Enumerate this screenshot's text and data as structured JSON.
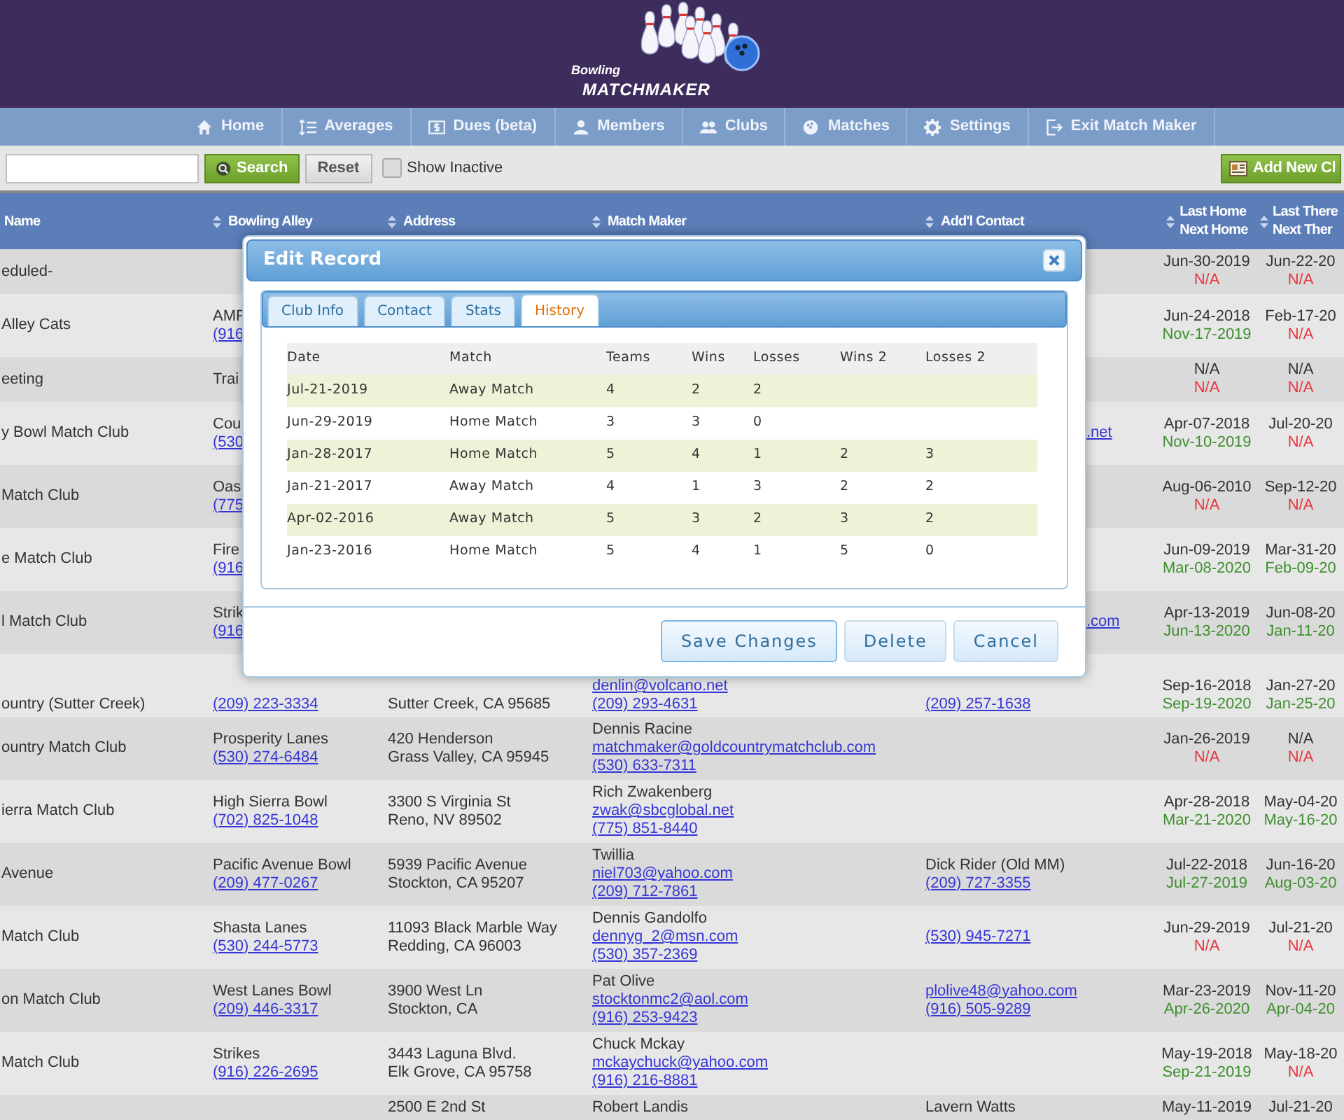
{
  "logo": {
    "script": "Bowling",
    "wordmark": "MATCHMAKER"
  },
  "nav": [
    {
      "label": "Home"
    },
    {
      "label": "Averages"
    },
    {
      "label": "Dues (beta)"
    },
    {
      "label": "Members"
    },
    {
      "label": "Clubs"
    },
    {
      "label": "Matches"
    },
    {
      "label": "Settings"
    },
    {
      "label": "Exit Match Maker"
    }
  ],
  "toolbar": {
    "search_button": "Search",
    "reset_button": "Reset",
    "show_inactive": {
      "label": "Show Inactive",
      "checked": false
    },
    "add_button": "Add New Cl"
  },
  "table": {
    "columns": [
      {
        "lines": [
          "Name"
        ]
      },
      {
        "lines": [
          "Bowling Alley"
        ]
      },
      {
        "lines": [
          "Address"
        ]
      },
      {
        "lines": [
          "Match Maker"
        ]
      },
      {
        "lines": [
          "Add'l Contact"
        ]
      },
      {
        "lines": [
          "Last Home",
          "Next Home"
        ]
      },
      {
        "lines": [
          "Last There",
          "Next Ther"
        ]
      }
    ],
    "rows": [
      {
        "cells": [
          [
            {
              "text": "eduled-",
              "kind": "text"
            }
          ],
          [],
          [],
          [],
          [],
          [
            {
              "text": "Jun-30-2019",
              "kind": "date"
            },
            {
              "text": "N/A",
              "kind": "next_none"
            }
          ],
          [
            {
              "text": "Jun-22-20",
              "kind": "date"
            },
            {
              "text": "N/A",
              "kind": "next_none"
            }
          ]
        ]
      },
      {
        "cells": [
          [
            {
              "text": "Alley Cats",
              "kind": "text"
            }
          ],
          [
            {
              "text": "AMF",
              "kind": "text"
            },
            {
              "text": "(916",
              "kind": "link"
            }
          ],
          [],
          [],
          [],
          [
            {
              "text": "Jun-24-2018",
              "kind": "date"
            },
            {
              "text": "Nov-17-2019",
              "kind": "next_set"
            }
          ],
          [
            {
              "text": "Feb-17-20",
              "kind": "date"
            },
            {
              "text": "N/A",
              "kind": "next_none"
            }
          ]
        ]
      },
      {
        "cells": [
          [
            {
              "text": "eeting",
              "kind": "text"
            }
          ],
          [
            {
              "text": "Trai",
              "kind": "text"
            }
          ],
          [],
          [],
          [],
          [
            {
              "text": "N/A",
              "kind": "date"
            },
            {
              "text": "N/A",
              "kind": "next_none"
            }
          ],
          [
            {
              "text": "N/A",
              "kind": "date"
            },
            {
              "text": "N/A",
              "kind": "next_none"
            }
          ]
        ]
      },
      {
        "cells": [
          [
            {
              "text": "y Bowl Match Club",
              "kind": "text"
            }
          ],
          [
            {
              "text": "Cou",
              "kind": "text"
            },
            {
              "text": "(530",
              "kind": "link"
            }
          ],
          [],
          [],
          [
            {
              "text": ".net",
              "kind": "tail_link"
            }
          ],
          [
            {
              "text": "Apr-07-2018",
              "kind": "date"
            },
            {
              "text": "Nov-10-2019",
              "kind": "next_set"
            }
          ],
          [
            {
              "text": "Jul-20-20",
              "kind": "date"
            },
            {
              "text": "N/A",
              "kind": "next_none"
            }
          ]
        ]
      },
      {
        "cells": [
          [
            {
              "text": "Match Club",
              "kind": "text"
            }
          ],
          [
            {
              "text": "Oas",
              "kind": "text"
            },
            {
              "text": "(775",
              "kind": "link"
            }
          ],
          [],
          [],
          [],
          [
            {
              "text": "Aug-06-2010",
              "kind": "date"
            },
            {
              "text": "N/A",
              "kind": "next_none"
            }
          ],
          [
            {
              "text": "Sep-12-20",
              "kind": "date"
            },
            {
              "text": "N/A",
              "kind": "next_none"
            }
          ]
        ]
      },
      {
        "cells": [
          [
            {
              "text": "e Match Club",
              "kind": "text"
            }
          ],
          [
            {
              "text": "Fire",
              "kind": "text"
            },
            {
              "text": "(916",
              "kind": "link"
            }
          ],
          [],
          [],
          [],
          [
            {
              "text": "Jun-09-2019",
              "kind": "date"
            },
            {
              "text": "Mar-08-2020",
              "kind": "next_set"
            }
          ],
          [
            {
              "text": "Mar-31-20",
              "kind": "date"
            },
            {
              "text": "Feb-09-20",
              "kind": "next_set"
            }
          ]
        ]
      },
      {
        "cells": [
          [
            {
              "text": "l Match Club",
              "kind": "text"
            }
          ],
          [
            {
              "text": "Strik",
              "kind": "text"
            },
            {
              "text": "(916",
              "kind": "link"
            }
          ],
          [],
          [],
          [
            {
              "text": ".com",
              "kind": "tail_link"
            }
          ],
          [
            {
              "text": "Apr-13-2019",
              "kind": "date"
            },
            {
              "text": "Jun-13-2020",
              "kind": "next_set"
            }
          ],
          [
            {
              "text": "Jun-08-20",
              "kind": "date"
            },
            {
              "text": "Jan-11-20",
              "kind": "next_set"
            }
          ]
        ]
      },
      {
        "covered_top": true,
        "cells": [
          [
            {
              "text": "ountry (Sutter Creek)",
              "kind": "text"
            }
          ],
          [
            {
              "text": "(209) 223-3334",
              "kind": "link"
            }
          ],
          [
            {
              "text": "Sutter Creek, CA 95685",
              "kind": "text"
            }
          ],
          [
            {
              "text": "denlin@volcano.net",
              "kind": "link"
            },
            {
              "text": "(209) 293-4631",
              "kind": "link"
            }
          ],
          [
            {
              "text": "(209) 257-1638",
              "kind": "link"
            }
          ],
          [
            {
              "text": "Sep-16-2018",
              "kind": "date"
            },
            {
              "text": "Sep-19-2020",
              "kind": "next_set"
            }
          ],
          [
            {
              "text": "Jan-27-20",
              "kind": "date"
            },
            {
              "text": "Jan-25-20",
              "kind": "next_set"
            }
          ]
        ]
      },
      {
        "cells": [
          [
            {
              "text": "ountry Match Club",
              "kind": "text"
            }
          ],
          [
            {
              "text": "Prosperity Lanes",
              "kind": "text"
            },
            {
              "text": "(530) 274-6484",
              "kind": "link"
            }
          ],
          [
            {
              "text": "420 Henderson",
              "kind": "text"
            },
            {
              "text": "Grass Valley, CA 95945",
              "kind": "text"
            }
          ],
          [
            {
              "text": "Dennis Racine",
              "kind": "text"
            },
            {
              "text": "matchmaker@goldcountrymatchclub.com",
              "kind": "link"
            },
            {
              "text": "(530) 633-7311",
              "kind": "link"
            }
          ],
          [],
          [
            {
              "text": "Jan-26-2019",
              "kind": "date"
            },
            {
              "text": "N/A",
              "kind": "next_none"
            }
          ],
          [
            {
              "text": "N/A",
              "kind": "date"
            },
            {
              "text": "N/A",
              "kind": "next_none"
            }
          ]
        ]
      },
      {
        "cells": [
          [
            {
              "text": "ierra Match Club",
              "kind": "text"
            }
          ],
          [
            {
              "text": "High Sierra Bowl",
              "kind": "text"
            },
            {
              "text": "(702) 825-1048",
              "kind": "link"
            }
          ],
          [
            {
              "text": "3300 S Virginia St",
              "kind": "text"
            },
            {
              "text": "Reno, NV 89502",
              "kind": "text"
            }
          ],
          [
            {
              "text": "Rich Zwakenberg",
              "kind": "text"
            },
            {
              "text": "zwak@sbcglobal.net",
              "kind": "link"
            },
            {
              "text": "(775) 851-8440",
              "kind": "link"
            }
          ],
          [],
          [
            {
              "text": "Apr-28-2018",
              "kind": "date"
            },
            {
              "text": "Mar-21-2020",
              "kind": "next_set"
            }
          ],
          [
            {
              "text": "May-04-20",
              "kind": "date"
            },
            {
              "text": "May-16-20",
              "kind": "next_set"
            }
          ]
        ]
      },
      {
        "cells": [
          [
            {
              "text": "Avenue",
              "kind": "text"
            }
          ],
          [
            {
              "text": "Pacific Avenue Bowl",
              "kind": "text"
            },
            {
              "text": "(209) 477-0267",
              "kind": "link"
            }
          ],
          [
            {
              "text": "5939 Pacific Avenue",
              "kind": "text"
            },
            {
              "text": "Stockton, CA 95207",
              "kind": "text"
            }
          ],
          [
            {
              "text": "Twillia",
              "kind": "text"
            },
            {
              "text": "niel703@yahoo.com",
              "kind": "link"
            },
            {
              "text": "(209) 712-7861",
              "kind": "link"
            }
          ],
          [
            {
              "text": "Dick Rider (Old MM)",
              "kind": "text"
            },
            {
              "text": "(209) 727-3355",
              "kind": "link"
            }
          ],
          [
            {
              "text": "Jul-22-2018",
              "kind": "date"
            },
            {
              "text": "Jul-27-2019",
              "kind": "next_set"
            }
          ],
          [
            {
              "text": "Jun-16-20",
              "kind": "date"
            },
            {
              "text": "Aug-03-20",
              "kind": "next_set"
            }
          ]
        ]
      },
      {
        "cells": [
          [
            {
              "text": "Match Club",
              "kind": "text"
            }
          ],
          [
            {
              "text": "Shasta Lanes",
              "kind": "text"
            },
            {
              "text": "(530) 244-5773",
              "kind": "link"
            }
          ],
          [
            {
              "text": "11093 Black Marble Way",
              "kind": "text"
            },
            {
              "text": "Redding, CA 96003",
              "kind": "text"
            }
          ],
          [
            {
              "text": "Dennis Gandolfo",
              "kind": "text"
            },
            {
              "text": "dennyg_2@msn.com",
              "kind": "link"
            },
            {
              "text": "(530) 357-2369",
              "kind": "link"
            }
          ],
          [
            {
              "text": "(530) 945-7271",
              "kind": "link"
            }
          ],
          [
            {
              "text": "Jun-29-2019",
              "kind": "date"
            },
            {
              "text": "N/A",
              "kind": "next_none"
            }
          ],
          [
            {
              "text": "Jul-21-20",
              "kind": "date"
            },
            {
              "text": "N/A",
              "kind": "next_none"
            }
          ]
        ]
      },
      {
        "cells": [
          [
            {
              "text": "on Match Club",
              "kind": "text"
            }
          ],
          [
            {
              "text": "West Lanes Bowl",
              "kind": "text"
            },
            {
              "text": "(209) 446-3317",
              "kind": "link"
            }
          ],
          [
            {
              "text": "3900 West Ln",
              "kind": "text"
            },
            {
              "text": "Stockton, CA",
              "kind": "text"
            }
          ],
          [
            {
              "text": "Pat Olive",
              "kind": "text"
            },
            {
              "text": "stocktonmc2@aol.com",
              "kind": "link"
            },
            {
              "text": "(916) 253-9423",
              "kind": "link"
            }
          ],
          [
            {
              "text": "plolive48@yahoo.com",
              "kind": "link"
            },
            {
              "text": "(916) 505-9289",
              "kind": "link"
            }
          ],
          [
            {
              "text": "Mar-23-2019",
              "kind": "date"
            },
            {
              "text": "Apr-26-2020",
              "kind": "next_set"
            }
          ],
          [
            {
              "text": "Nov-11-20",
              "kind": "date"
            },
            {
              "text": "Apr-04-20",
              "kind": "next_set"
            }
          ]
        ]
      },
      {
        "cells": [
          [
            {
              "text": "Match Club",
              "kind": "text"
            }
          ],
          [
            {
              "text": "Strikes",
              "kind": "text"
            },
            {
              "text": "(916) 226-2695",
              "kind": "link"
            }
          ],
          [
            {
              "text": "3443 Laguna Blvd.",
              "kind": "text"
            },
            {
              "text": "Elk Grove, CA 95758",
              "kind": "text"
            }
          ],
          [
            {
              "text": "Chuck Mckay",
              "kind": "text"
            },
            {
              "text": "mckaychuck@yahoo.com",
              "kind": "link"
            },
            {
              "text": "(916) 216-8881",
              "kind": "link"
            }
          ],
          [],
          [
            {
              "text": "May-19-2018",
              "kind": "date"
            },
            {
              "text": "Sep-21-2019",
              "kind": "next_set"
            }
          ],
          [
            {
              "text": "May-18-20",
              "kind": "date"
            },
            {
              "text": "N/A",
              "kind": "next_none"
            }
          ]
        ]
      },
      {
        "cut_bottom": true,
        "cells": [
          [],
          [],
          [
            {
              "text": "2500 E 2nd St",
              "kind": "text"
            }
          ],
          [
            {
              "text": "Robert Landis",
              "kind": "text"
            }
          ],
          [
            {
              "text": "Lavern Watts",
              "kind": "text"
            }
          ],
          [
            {
              "text": "May-11-2019",
              "kind": "date"
            }
          ],
          [
            {
              "text": "Jul-21-20",
              "kind": "date"
            }
          ]
        ]
      }
    ]
  },
  "modal": {
    "title": "Edit Record",
    "tabs": [
      {
        "label": "Club Info",
        "selected": false
      },
      {
        "label": "Contact",
        "selected": false
      },
      {
        "label": "Stats",
        "selected": false
      },
      {
        "label": "History",
        "selected": true
      }
    ],
    "history": {
      "columns": [
        "Date",
        "Match",
        "Teams",
        "Wins",
        "Losses",
        "Wins 2",
        "Losses 2"
      ],
      "rows": [
        [
          "Jul-21-2019",
          "Away Match",
          "4",
          "2",
          "2",
          "",
          ""
        ],
        [
          "Jun-29-2019",
          "Home Match",
          "3",
          "3",
          "0",
          "",
          ""
        ],
        [
          "Jan-28-2017",
          "Home Match",
          "5",
          "4",
          "1",
          "2",
          "3"
        ],
        [
          "Jan-21-2017",
          "Away Match",
          "4",
          "1",
          "3",
          "2",
          "2"
        ],
        [
          "Apr-02-2016",
          "Away Match",
          "5",
          "3",
          "2",
          "3",
          "2"
        ],
        [
          "Jan-23-2016",
          "Home Match",
          "5",
          "4",
          "1",
          "5",
          "0"
        ]
      ]
    },
    "buttons": [
      {
        "label": "Save Changes",
        "focused": true
      },
      {
        "label": "Delete",
        "focused": false
      },
      {
        "label": "Cancel",
        "focused": false
      }
    ]
  }
}
